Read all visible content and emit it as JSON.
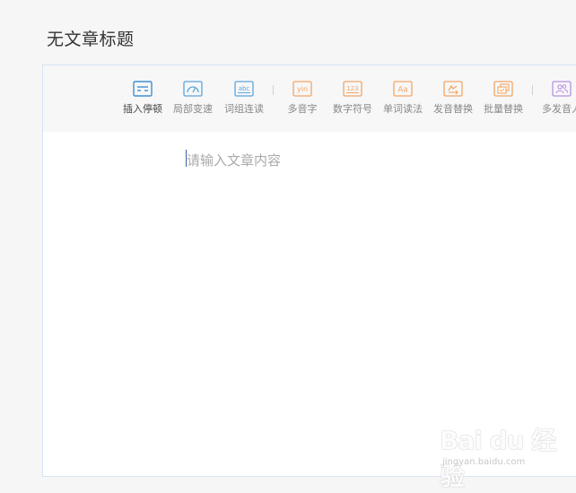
{
  "document": {
    "title": "无文章标题",
    "placeholder": "请输入文章内容"
  },
  "toolbar": {
    "tools": [
      {
        "label": "插入停顿",
        "icon": "pause-insert-icon",
        "color": "#3f8fd2"
      },
      {
        "label": "局部变速",
        "icon": "speedometer-icon",
        "color": "#5aa6dc"
      },
      {
        "label": "词组连读",
        "icon": "abc-icon",
        "color": "#5aa6dc"
      },
      {
        "label": "多音字",
        "icon": "yin-icon",
        "color": "#f3a564"
      },
      {
        "label": "数字符号",
        "icon": "number-123-icon",
        "color": "#f3a564"
      },
      {
        "label": "单词读法",
        "icon": "aa-icon",
        "color": "#f3a564"
      },
      {
        "label": "发音替换",
        "icon": "swap-icon",
        "color": "#f3a564"
      },
      {
        "label": "批量替换",
        "icon": "batch-replace-icon",
        "color": "#f3a564"
      },
      {
        "label": "多发音人",
        "icon": "multi-speaker-icon",
        "color": "#b98fe0"
      }
    ],
    "inactive_label_color": "#888888",
    "active_label_color": "#444444"
  },
  "watermark": {
    "logo_text": "Bai du 经验",
    "url": "jingyan.baidu.com"
  }
}
